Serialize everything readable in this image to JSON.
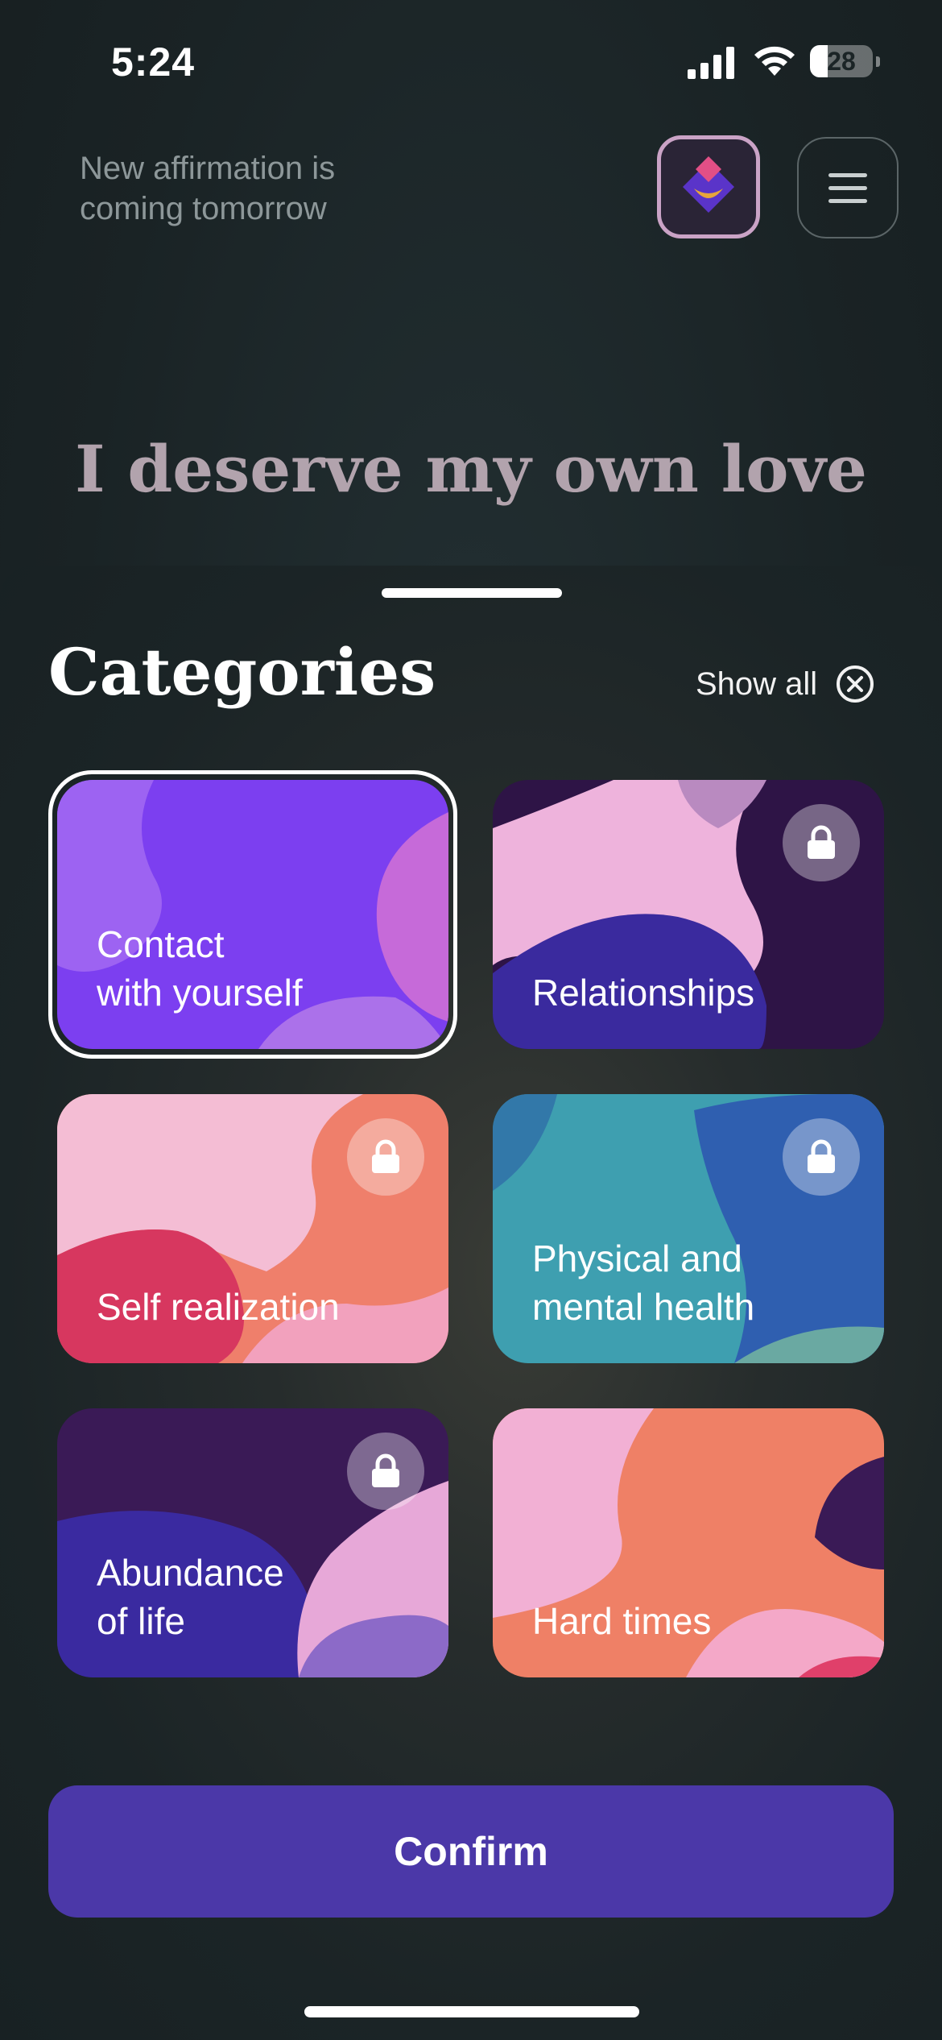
{
  "status_bar": {
    "time": "5:24",
    "battery_level": "28",
    "battery_fraction": 0.28,
    "icons": [
      "signal-icon",
      "wifi-icon",
      "battery-icon"
    ]
  },
  "header": {
    "next_note": "New affirmation is coming tomorrow",
    "logo_icon": "app-logo-icon",
    "menu_icon": "hamburger-menu-icon"
  },
  "affirmation": {
    "text": "I deserve my own love"
  },
  "categories": {
    "title": "Categories",
    "show_all_label": "Show all",
    "show_all_icon": "close-circle-icon",
    "items": [
      {
        "label": "Contact\nwith yourself",
        "locked": false,
        "selected": true
      },
      {
        "label": "Relationships",
        "locked": true,
        "selected": false
      },
      {
        "label": "Self realization",
        "locked": true,
        "selected": false
      },
      {
        "label": "Physical and\nmental health",
        "locked": true,
        "selected": false
      },
      {
        "label": "Abundance\nof life",
        "locked": true,
        "selected": false
      },
      {
        "label": "Hard times",
        "locked": false,
        "selected": false
      }
    ]
  },
  "confirm_label": "Confirm",
  "colors": {
    "background": "#1b2426",
    "accent": "#4b38a8",
    "logo_border": "#caa3c6"
  }
}
